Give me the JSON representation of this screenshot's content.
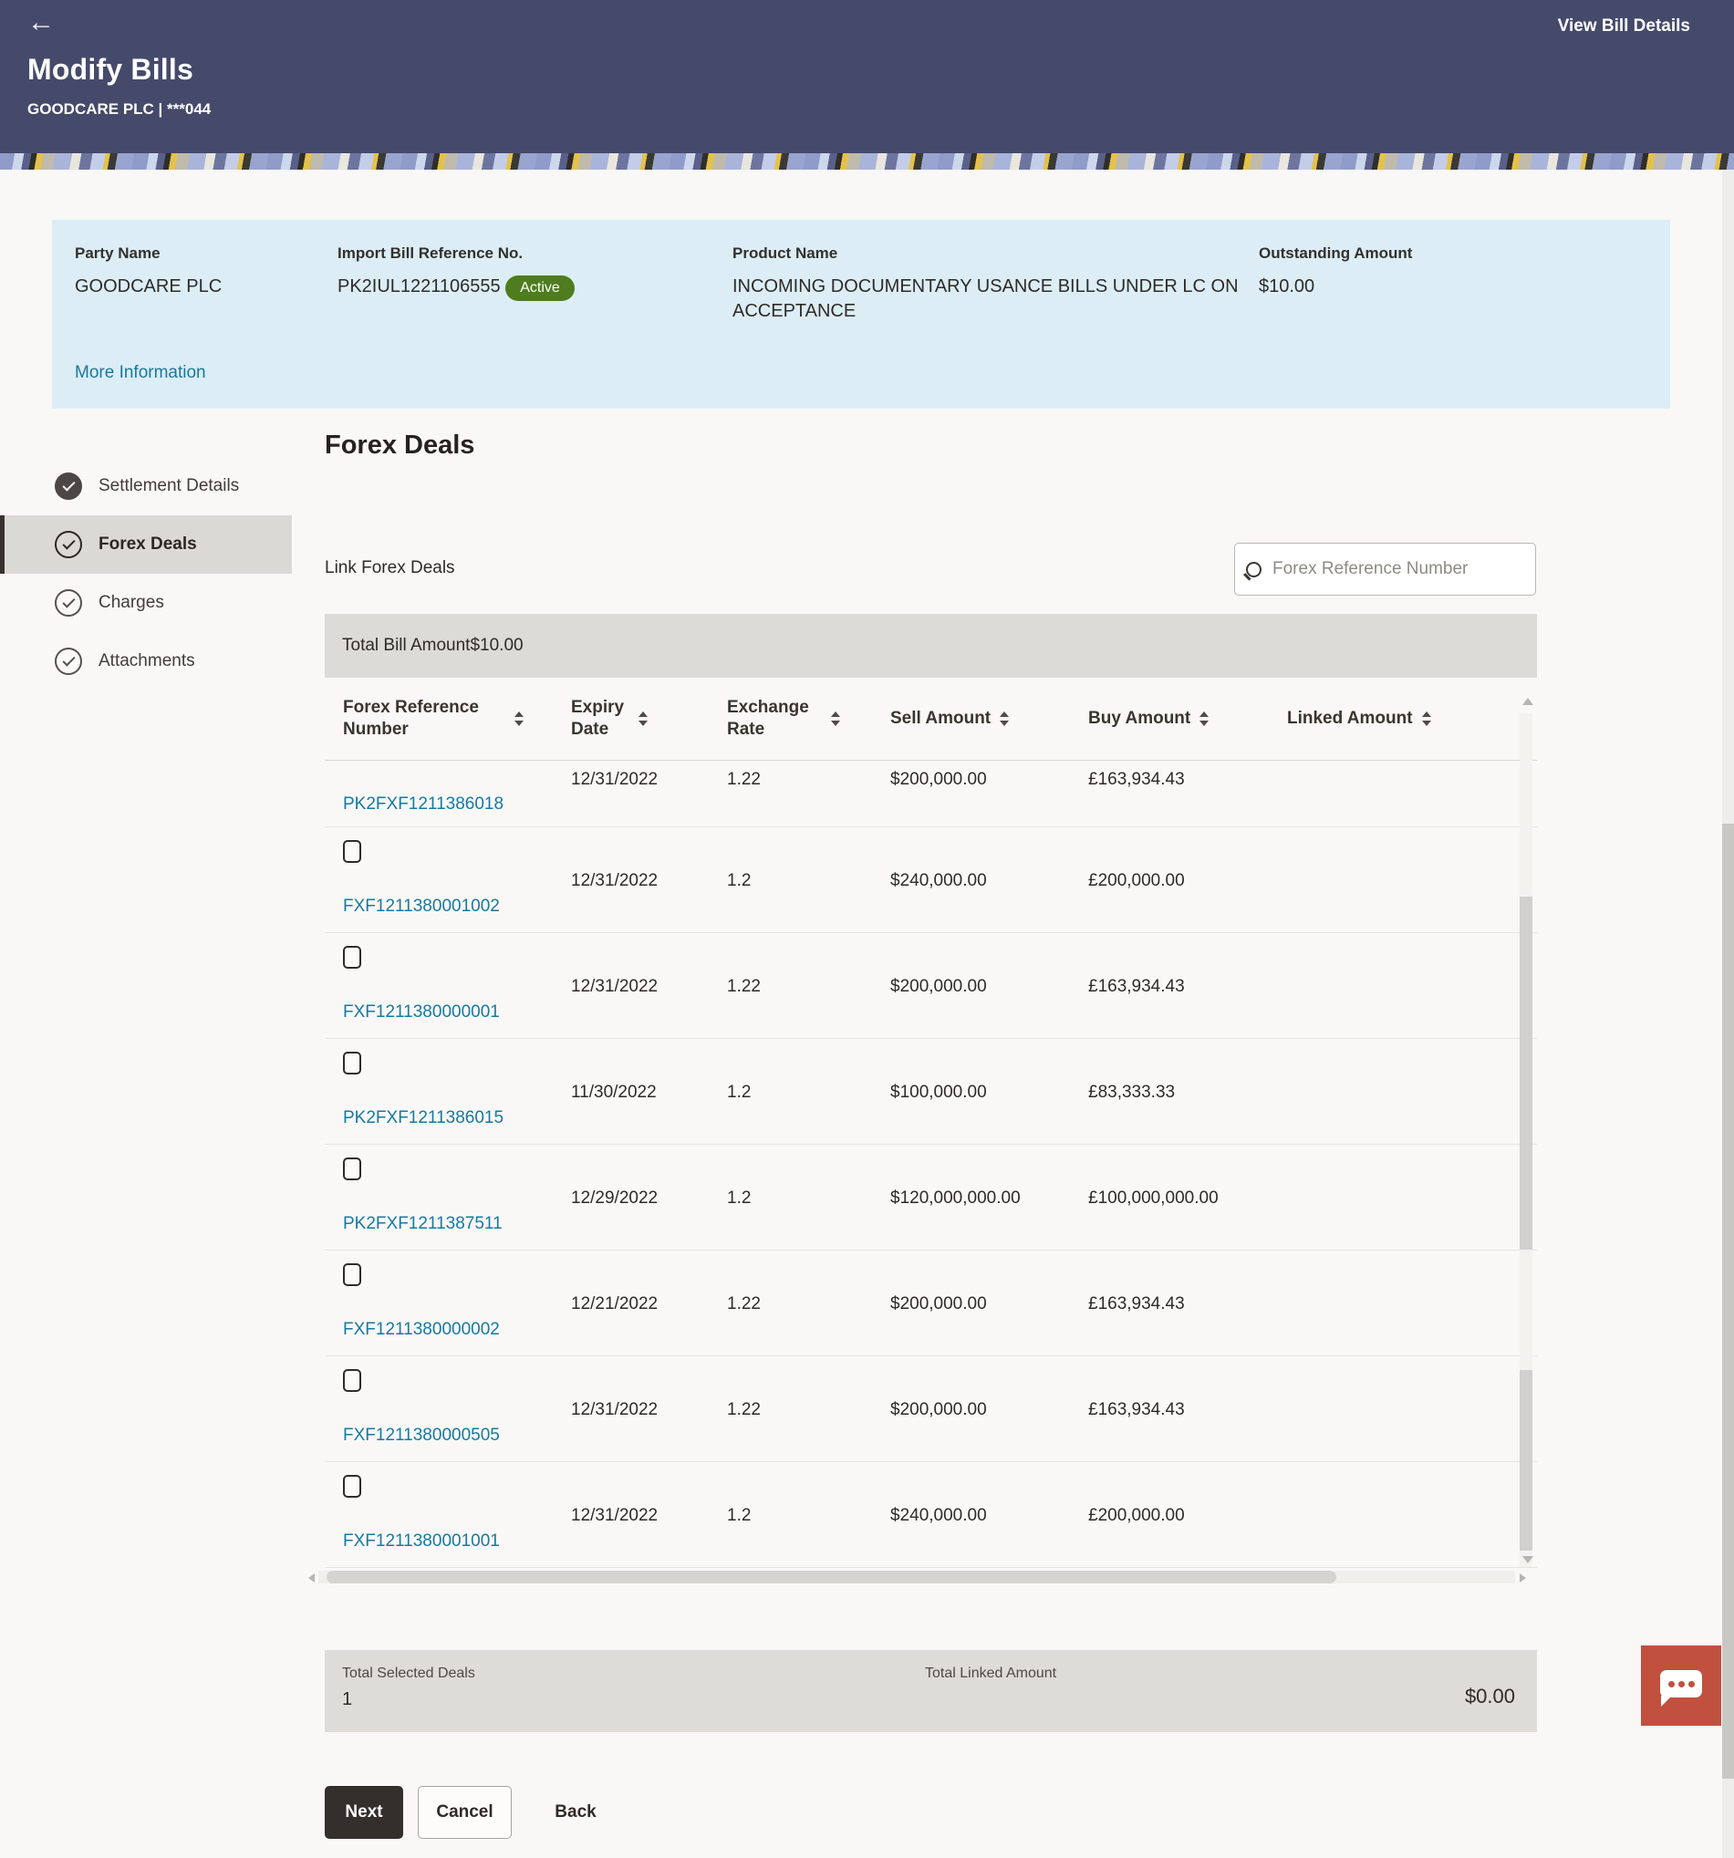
{
  "colors": {
    "header_bg": "#454a6b",
    "panel_bg": "#dcedf6",
    "badge_green": "#4e7c1e",
    "link_teal": "#1779a0",
    "chat_red": "#c1503e",
    "bar_grey": "#dcdbd8",
    "button_dark": "#332f2b"
  },
  "header": {
    "back_glyph": "←",
    "title": "Modify Bills",
    "subtitle": "GOODCARE PLC | ***044",
    "action_label": "View Bill Details"
  },
  "bill_summary": {
    "fields": [
      {
        "label": "Party Name",
        "value": "GOODCARE PLC"
      },
      {
        "label": "Import Bill Reference No.",
        "value": "PK2IUL1221106555",
        "badge": "Active"
      },
      {
        "label": "Product Name",
        "value": "INCOMING DOCUMENTARY USANCE BILLS UNDER LC ON ACCEPTANCE"
      },
      {
        "label": "Outstanding Amount",
        "value": "$10.00"
      }
    ],
    "more_info_label": "More Information"
  },
  "sidebar": {
    "items": [
      {
        "label": "Settlement Details",
        "state": "completed",
        "icon": "check-circle-filled"
      },
      {
        "label": "Forex Deals",
        "state": "active",
        "icon": "check-circle-outline"
      },
      {
        "label": "Charges",
        "state": "default",
        "icon": "check-circle-outline"
      },
      {
        "label": "Attachments",
        "state": "default",
        "icon": "check-circle-outline"
      }
    ]
  },
  "forex": {
    "section_title": "Forex Deals",
    "link_label": "Link Forex Deals",
    "search_placeholder": "Forex Reference Number",
    "total_bill_label": "Total Bill Amount",
    "total_bill_value": "$10.00"
  },
  "table": {
    "columns": [
      {
        "label": "Forex Reference Number",
        "sortable": true
      },
      {
        "label": "Expiry Date",
        "sortable": true
      },
      {
        "label": "Exchange Rate",
        "sortable": true
      },
      {
        "label": "Sell Amount",
        "sortable": true
      },
      {
        "label": "Buy Amount",
        "sortable": true
      },
      {
        "label": "Linked Amount",
        "sortable": true
      }
    ],
    "rows": [
      {
        "ref": "PK2FXF1211386018",
        "expiry": "12/31/2022",
        "rate": "1.22",
        "sell": "$200,000.00",
        "buy": "£163,934.43",
        "linked": ""
      },
      {
        "ref": "FXF1211380001002",
        "expiry": "12/31/2022",
        "rate": "1.2",
        "sell": "$240,000.00",
        "buy": "£200,000.00",
        "linked": ""
      },
      {
        "ref": "FXF1211380000001",
        "expiry": "12/31/2022",
        "rate": "1.22",
        "sell": "$200,000.00",
        "buy": "£163,934.43",
        "linked": ""
      },
      {
        "ref": "PK2FXF1211386015",
        "expiry": "11/30/2022",
        "rate": "1.2",
        "sell": "$100,000.00",
        "buy": "£83,333.33",
        "linked": ""
      },
      {
        "ref": "PK2FXF1211387511",
        "expiry": "12/29/2022",
        "rate": "1.2",
        "sell": "$120,000,000.00",
        "buy": "£100,000,000.00",
        "linked": ""
      },
      {
        "ref": "FXF1211380000002",
        "expiry": "12/21/2022",
        "rate": "1.22",
        "sell": "$200,000.00",
        "buy": "£163,934.43",
        "linked": ""
      },
      {
        "ref": "FXF1211380000505",
        "expiry": "12/31/2022",
        "rate": "1.22",
        "sell": "$200,000.00",
        "buy": "£163,934.43",
        "linked": ""
      },
      {
        "ref": "FXF1211380001001",
        "expiry": "12/31/2022",
        "rate": "1.2",
        "sell": "$240,000.00",
        "buy": "£200,000.00",
        "linked": ""
      }
    ]
  },
  "totals": {
    "selected_label": "Total Selected Deals",
    "selected_value": "1",
    "linked_label": "Total Linked Amount",
    "linked_value": "$0.00"
  },
  "actions": {
    "next_label": "Next",
    "cancel_label": "Cancel",
    "back_label": "Back"
  }
}
